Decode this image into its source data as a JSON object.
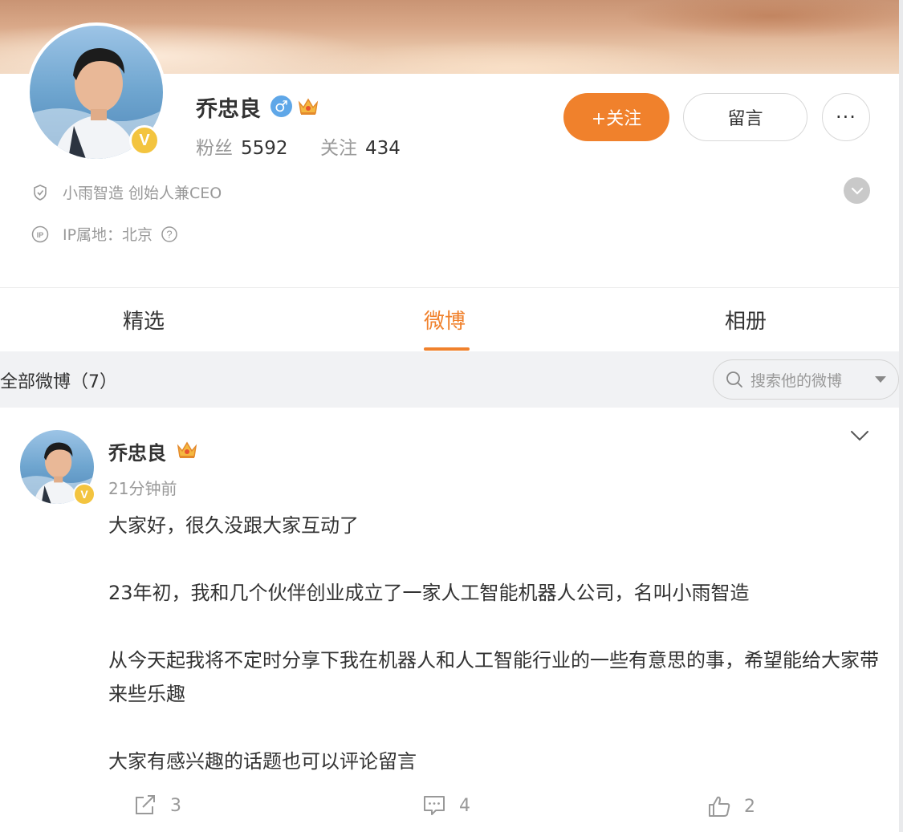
{
  "profile": {
    "name": "乔忠良",
    "gender_symbol": "♂",
    "fans_label": "粉丝",
    "fans_count": "5592",
    "following_label": "关注",
    "following_count": "434",
    "follow_button": "+关注",
    "message_button": "留言",
    "more_button": "···",
    "verification": "小雨智造 创始人兼CEO",
    "ip_location": "IP属地：北京",
    "verified_badge": "V"
  },
  "tabs": [
    {
      "label": "精选",
      "active": false
    },
    {
      "label": "微博",
      "active": true
    },
    {
      "label": "相册",
      "active": false
    }
  ],
  "filter": {
    "title": "全部微博（7）",
    "search_placeholder": "搜索他的微博"
  },
  "post": {
    "author": "乔忠良",
    "time": "21分钟前",
    "paragraphs": [
      "大家好，很久没跟大家互动了",
      "23年初，我和几个伙伴创业成立了一家人工智能机器人公司，名叫小雨智造",
      "从今天起我将不定时分享下我在机器人和人工智能行业的一些有意思的事，希望能给大家带来些乐趣",
      "大家有感兴趣的话题也可以评论留言"
    ],
    "reposts": "3",
    "comments": "4",
    "likes": "2"
  },
  "colors": {
    "accent": "#f0812c",
    "gender_blue": "#5fa7e8",
    "verified_gold": "#f3c43f"
  },
  "icons": [
    "shield-icon",
    "ip-icon",
    "help-icon",
    "chevron-down-icon",
    "search-icon",
    "dropdown-caret-icon",
    "repost-icon",
    "comment-icon",
    "like-icon",
    "crown-icon"
  ]
}
